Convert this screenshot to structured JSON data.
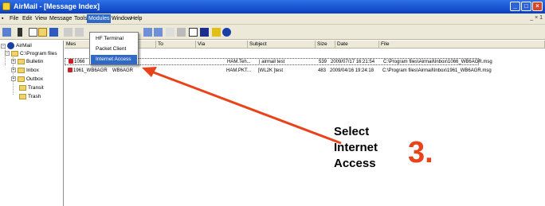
{
  "window": {
    "title": "AirMail - [Message Index]"
  },
  "menu": [
    "File",
    "Edit",
    "View",
    "Message",
    "Tools",
    "Modules",
    "Window",
    "Help"
  ],
  "active_menu": "Modules",
  "mdi_controls": "_ × 1",
  "modules_menu": {
    "items": [
      "HF Terminal",
      "Packet Client",
      "Internet Access"
    ],
    "highlighted": "Internet Access"
  },
  "tree": {
    "root": "AirMail",
    "path": "C:\\Program files",
    "folders": [
      "Bulletin",
      "Inbox",
      "Outbox",
      "Transit",
      "Trash"
    ]
  },
  "columns": [
    "Mes",
    "To",
    "Via",
    "Subject",
    "Size",
    "Date",
    "File"
  ],
  "messages": [
    {
      "id": "1066",
      "from": "",
      "to": "",
      "via": "HAM.Teh...",
      "subject": "| airmail test",
      "size": "539",
      "date": "2009/07/17 16:21:54",
      "file": "C:\\Program files\\Airmail\\Inbox\\1066_WB6AGR.msg"
    },
    {
      "id": "1961_WB6AGR",
      "from": "WB6AGR",
      "to": "",
      "via": "HAM.PKT...",
      "subject": "[WL2K ]test",
      "size": "483",
      "date": "2009/04/16 19:24:18",
      "file": "C:\\Program files\\Airmail\\Inbox\\1961_WB6AGR.msg"
    }
  ],
  "annotation": {
    "lines": [
      "Select",
      "Internet",
      "Access"
    ],
    "step": "3.",
    "accent": "#e8431a"
  }
}
